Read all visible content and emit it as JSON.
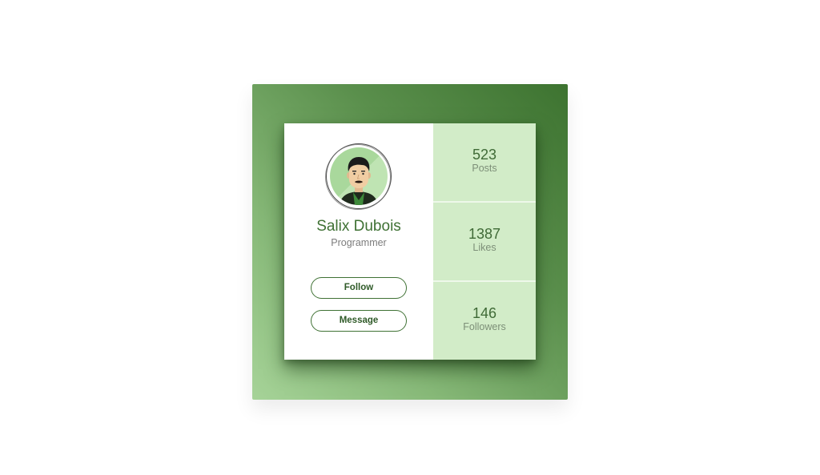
{
  "profile": {
    "name": "Salix Dubois",
    "role": "Programmer",
    "avatar_icon": "man-avatar-illustration",
    "follow_label": "Follow",
    "message_label": "Message"
  },
  "stats": [
    {
      "value": "523",
      "label": "Posts"
    },
    {
      "value": "1387",
      "label": "Likes"
    },
    {
      "value": "146",
      "label": "Followers"
    }
  ],
  "colors": {
    "accent": "#3f7134",
    "stats_background": "#d2ecc8",
    "gradient_dark": "#3d7330",
    "gradient_light": "#a6d398"
  }
}
